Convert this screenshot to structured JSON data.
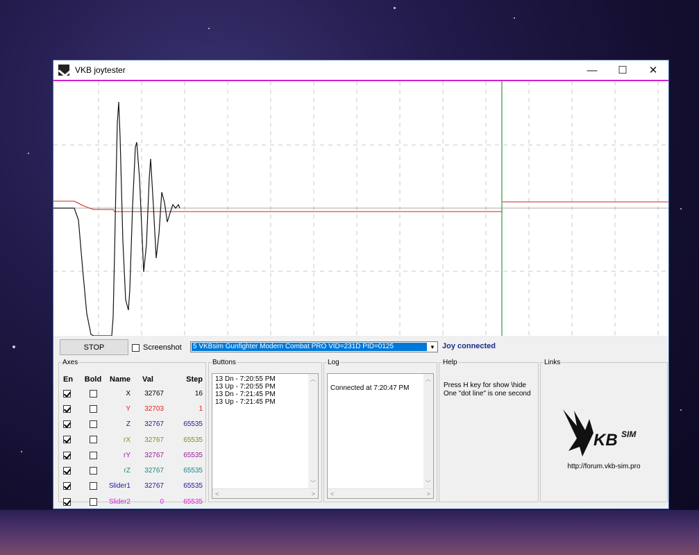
{
  "window": {
    "title": "VKB joytester",
    "logo_icon": "vkb-app-icon"
  },
  "titlebar_buttons": {
    "minimize": "—",
    "maximize": "☐",
    "close": "✕"
  },
  "toolbar": {
    "stop_label": "STOP",
    "screenshot_label": "Screenshot",
    "screenshot_checked": false,
    "device_selected": "5 VKBsim Gunfighter Modern Combat PRO  VID=231D PID=0125",
    "status": "Joy connected"
  },
  "axes": {
    "legend": "Axes",
    "headers": {
      "en": "En",
      "bold": "Bold",
      "name": "Name",
      "val": "Val",
      "step": "Step"
    },
    "rows": [
      {
        "en": true,
        "bold": false,
        "name": "X",
        "val": "32767",
        "step": "16",
        "color": "#000000"
      },
      {
        "en": true,
        "bold": false,
        "name": "Y",
        "val": "32703",
        "step": "1",
        "color": "#e02020"
      },
      {
        "en": true,
        "bold": false,
        "name": "Z",
        "val": "32767",
        "step": "65535",
        "color": "#1a1aa0"
      },
      {
        "en": true,
        "bold": false,
        "name": "rX",
        "val": "32767",
        "step": "65535",
        "color": "#8a8a2a"
      },
      {
        "en": true,
        "bold": false,
        "name": "rY",
        "val": "32767",
        "step": "65535",
        "color": "#9a1a9a"
      },
      {
        "en": true,
        "bold": false,
        "name": "rZ",
        "val": "32767",
        "step": "65535",
        "color": "#1a8a8a"
      },
      {
        "en": true,
        "bold": false,
        "name": "Slider1",
        "val": "32767",
        "step": "65535",
        "color": "#1a1aa0"
      },
      {
        "en": true,
        "bold": false,
        "name": "Slider2",
        "val": "0",
        "step": "65535",
        "color": "#e020e0"
      }
    ]
  },
  "buttons_panel": {
    "legend": "Buttons",
    "lines": [
      "13 Dn - 7:20:55 PM",
      "13 Up - 7:20:55 PM",
      "13 Dn - 7:21:45 PM",
      "13 Up - 7:21:45 PM"
    ]
  },
  "log_panel": {
    "legend": "Log",
    "lines": [
      "Connected at 7:20:47 PM"
    ]
  },
  "help_panel": {
    "legend": "Help",
    "lines": [
      "Press H key for show \\hide",
      "One \"dot line\" is one second"
    ]
  },
  "links_panel": {
    "legend": "Links",
    "logo_icon": "vkbsim-logo",
    "url": "http://forum.vkb-sim.pro"
  }
}
